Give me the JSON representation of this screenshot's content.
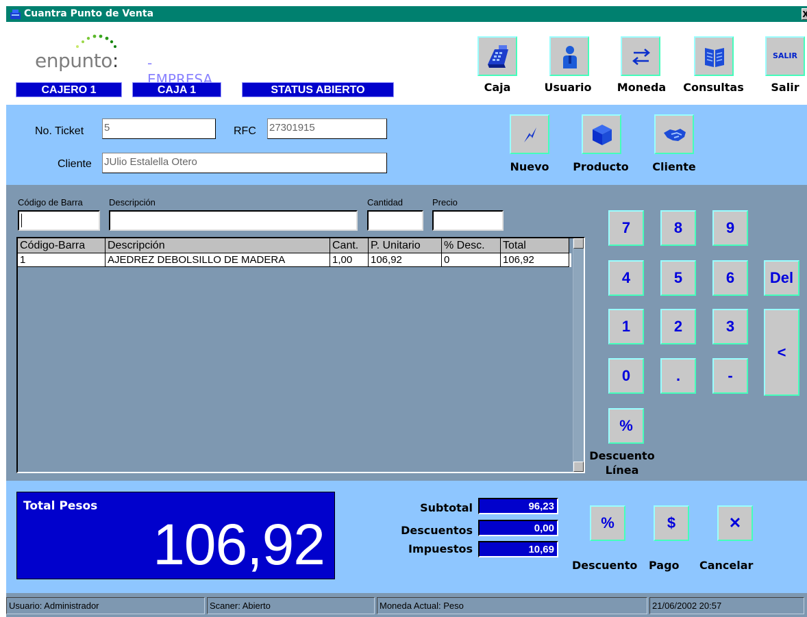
{
  "window": {
    "title": "Cuantra Punto de Venta",
    "close_glyph": "X"
  },
  "logo": {
    "word": "enpunto",
    "colon": ":",
    "company": "- EMPRESA"
  },
  "status": {
    "cajero": "CAJERO 1",
    "caja": "CAJA 1",
    "estado": "STATUS ABIERTO"
  },
  "toolbar": {
    "caja": "Caja",
    "usuario": "Usuario",
    "moneda": "Moneda",
    "consultas": "Consultas",
    "salir": "Salir",
    "salir_icon_text": "SALIR"
  },
  "ticket": {
    "ticket_label": "No. Ticket",
    "ticket_value": "5",
    "rfc_label": "RFC",
    "rfc_value": "27301915",
    "cliente_label": "Cliente",
    "cliente_value": "JUlio Estalella Otero",
    "nuevo": "Nuevo",
    "producto": "Producto",
    "cliente_btn": "Cliente"
  },
  "entry": {
    "codigo_label": "Código de Barra",
    "descripcion_label": "Descripción",
    "cantidad_label": "Cantidad",
    "precio_label": "Precio"
  },
  "grid": {
    "headers": [
      "Código-Barra",
      "Descripción",
      "Cant.",
      "P. Unitario",
      "% Desc.",
      "Total"
    ],
    "rows": [
      [
        "1",
        "AJEDREZ DEBOLSILLO DE MADERA",
        "1,00",
        "106,92",
        "0",
        "106,92"
      ]
    ]
  },
  "keypad": {
    "k7": "7",
    "k8": "8",
    "k9": "9",
    "k4": "4",
    "k5": "5",
    "k6": "6",
    "del": "Del",
    "k1": "1",
    "k2": "2",
    "k3": "3",
    "back": "<",
    "k0": "0",
    "dot": ".",
    "minus": "-",
    "pct": "%",
    "descuento_linea_1": "Descuento",
    "descuento_linea_2": "Línea"
  },
  "totals": {
    "label": "Total Pesos",
    "value": "106,92",
    "subtotal_label": "Subtotal",
    "subtotal_value": "96,23",
    "descuentos_label": "Descuentos",
    "descuentos_value": "0,00",
    "impuestos_label": "Impuestos",
    "impuestos_value": "10,69"
  },
  "actions": {
    "descuento_icon": "%",
    "pago_icon": "$",
    "cancelar_icon": "✕",
    "descuento": "Descuento",
    "pago": "Pago",
    "cancelar": "Cancelar"
  },
  "statusbar": {
    "usuario": "Usuario: Administrador",
    "scaner": "Scaner: Abierto",
    "moneda": "Moneda Actual: Peso",
    "fecha": "21/06/2002 20:57"
  },
  "colors": {
    "title_bar": "#00806f",
    "panel_light": "#8ec6ff",
    "panel_dark": "#7e98b1",
    "accent_blue": "#0101cc",
    "key_text": "#0000dd"
  }
}
